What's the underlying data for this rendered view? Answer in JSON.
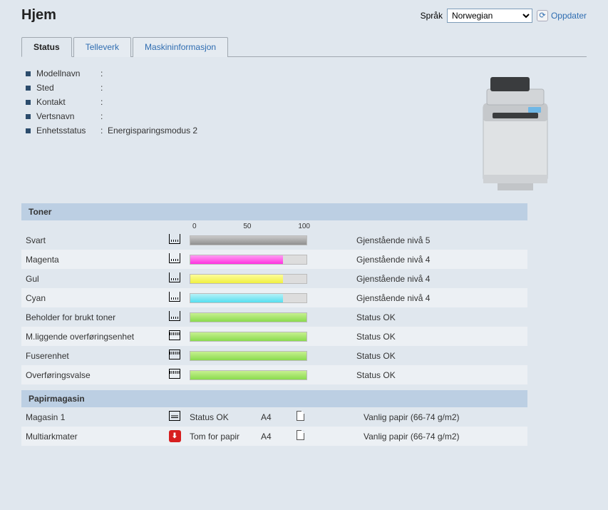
{
  "title": "Hjem",
  "language": {
    "label": "Språk",
    "value": "Norwegian"
  },
  "refresh_label": "Oppdater",
  "tabs": [
    {
      "label": "Status",
      "active": true
    },
    {
      "label": "Telleverk",
      "active": false
    },
    {
      "label": "Maskininformasjon",
      "active": false
    }
  ],
  "info": [
    {
      "label": "Modellnavn",
      "value": ""
    },
    {
      "label": "Sted",
      "value": ""
    },
    {
      "label": "Kontakt",
      "value": ""
    },
    {
      "label": "Vertsnavn",
      "value": ""
    },
    {
      "label": "Enhetsstatus",
      "value": "Energisparingsmodus 2"
    }
  ],
  "toner_section_title": "Toner",
  "scale": {
    "min": "0",
    "mid": "50",
    "max": "100"
  },
  "toner": [
    {
      "name": "Svart",
      "icon": "cart",
      "fill": 100,
      "color": "linear-gradient(#c9c9c9,#8f8f8f)",
      "status": "Gjenstående nivå 5"
    },
    {
      "name": "Magenta",
      "icon": "cart",
      "fill": 80,
      "color": "linear-gradient(#ff9df2,#ff33e0)",
      "status": "Gjenstående nivå 4"
    },
    {
      "name": "Gul",
      "icon": "cart",
      "fill": 80,
      "color": "linear-gradient(#fdfd9a,#f1f142)",
      "status": "Gjenstående nivå 4"
    },
    {
      "name": "Cyan",
      "icon": "cart",
      "fill": 80,
      "color": "linear-gradient(#b7f1f7,#55dff0)",
      "status": "Gjenstående nivå 4"
    },
    {
      "name": "Beholder for brukt toner",
      "icon": "cart",
      "fill": 100,
      "color": "linear-gradient(#c7f090,#8adb4e)",
      "status": "Status OK"
    },
    {
      "name": "M.liggende overføringsenhet",
      "icon": "comp",
      "fill": 100,
      "color": "linear-gradient(#c7f090,#8adb4e)",
      "status": "Status OK"
    },
    {
      "name": "Fuserenhet",
      "icon": "comp",
      "fill": 100,
      "color": "linear-gradient(#c7f090,#8adb4e)",
      "status": "Status OK"
    },
    {
      "name": "Overføringsvalse",
      "icon": "comp",
      "fill": 100,
      "color": "linear-gradient(#c7f090,#8adb4e)",
      "status": "Status OK"
    }
  ],
  "tray_section_title": "Papirmagasin",
  "trays": [
    {
      "name": "Magasin 1",
      "icon": "ok",
      "status": "Status OK",
      "size": "A4",
      "type": "Vanlig papir (66-74 g/m2)"
    },
    {
      "name": "Multiarkmater",
      "icon": "err",
      "status": "Tom for papir",
      "size": "A4",
      "type": "Vanlig papir (66-74 g/m2)"
    }
  ]
}
